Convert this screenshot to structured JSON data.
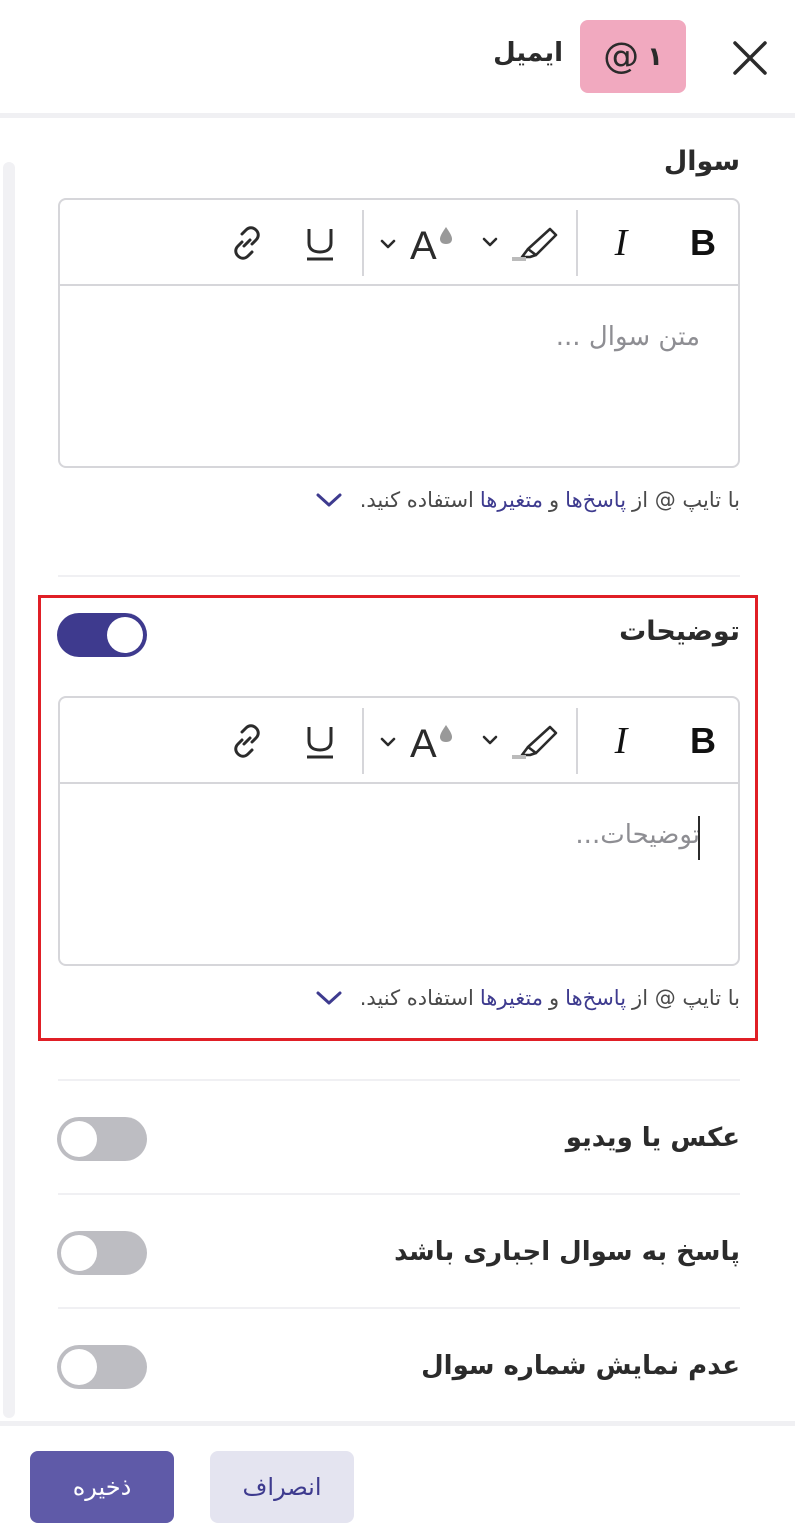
{
  "header": {
    "title": "ایمیل",
    "question_number": "۱",
    "type_icon": "at-icon",
    "close_icon": "close-icon"
  },
  "question_section": {
    "title": "سوال",
    "placeholder": "متن سوال ...",
    "hint": {
      "prefix": "با تایپ @ از",
      "link1": "پاسخ‌ها",
      "and": "و",
      "link2": "متغیرها",
      "suffix": "استفاده کنید."
    }
  },
  "description_section": {
    "title": "توضیحات",
    "enabled": true,
    "placeholder": "توضیحات...",
    "hint": {
      "prefix": "با تایپ @ از",
      "link1": "پاسخ‌ها",
      "and": "و",
      "link2": "متغیرها",
      "suffix": "استفاده کنید."
    }
  },
  "toolbar": {
    "bold_label": "B",
    "italic_label": "I",
    "underline_label": "U",
    "font_color_label": "A",
    "icons": [
      "bold-icon",
      "italic-icon",
      "highlight-icon",
      "font-color-icon",
      "underline-icon",
      "link-icon"
    ]
  },
  "options": [
    {
      "label": "عکس یا ویدیو",
      "enabled": false
    },
    {
      "label": "پاسخ به سوال اجباری باشد",
      "enabled": false
    },
    {
      "label": "عدم نمایش شماره سوال",
      "enabled": false
    }
  ],
  "footer": {
    "save_label": "ذخیره",
    "cancel_label": "انصراف"
  },
  "colors": {
    "primary": "#3e3a8e",
    "save_button": "#5f5aa8",
    "cancel_button": "#e4e4f0",
    "badge": "#f1a9bf",
    "highlight_box": "#e01f26",
    "toggle_off": "#bdbdc2"
  }
}
